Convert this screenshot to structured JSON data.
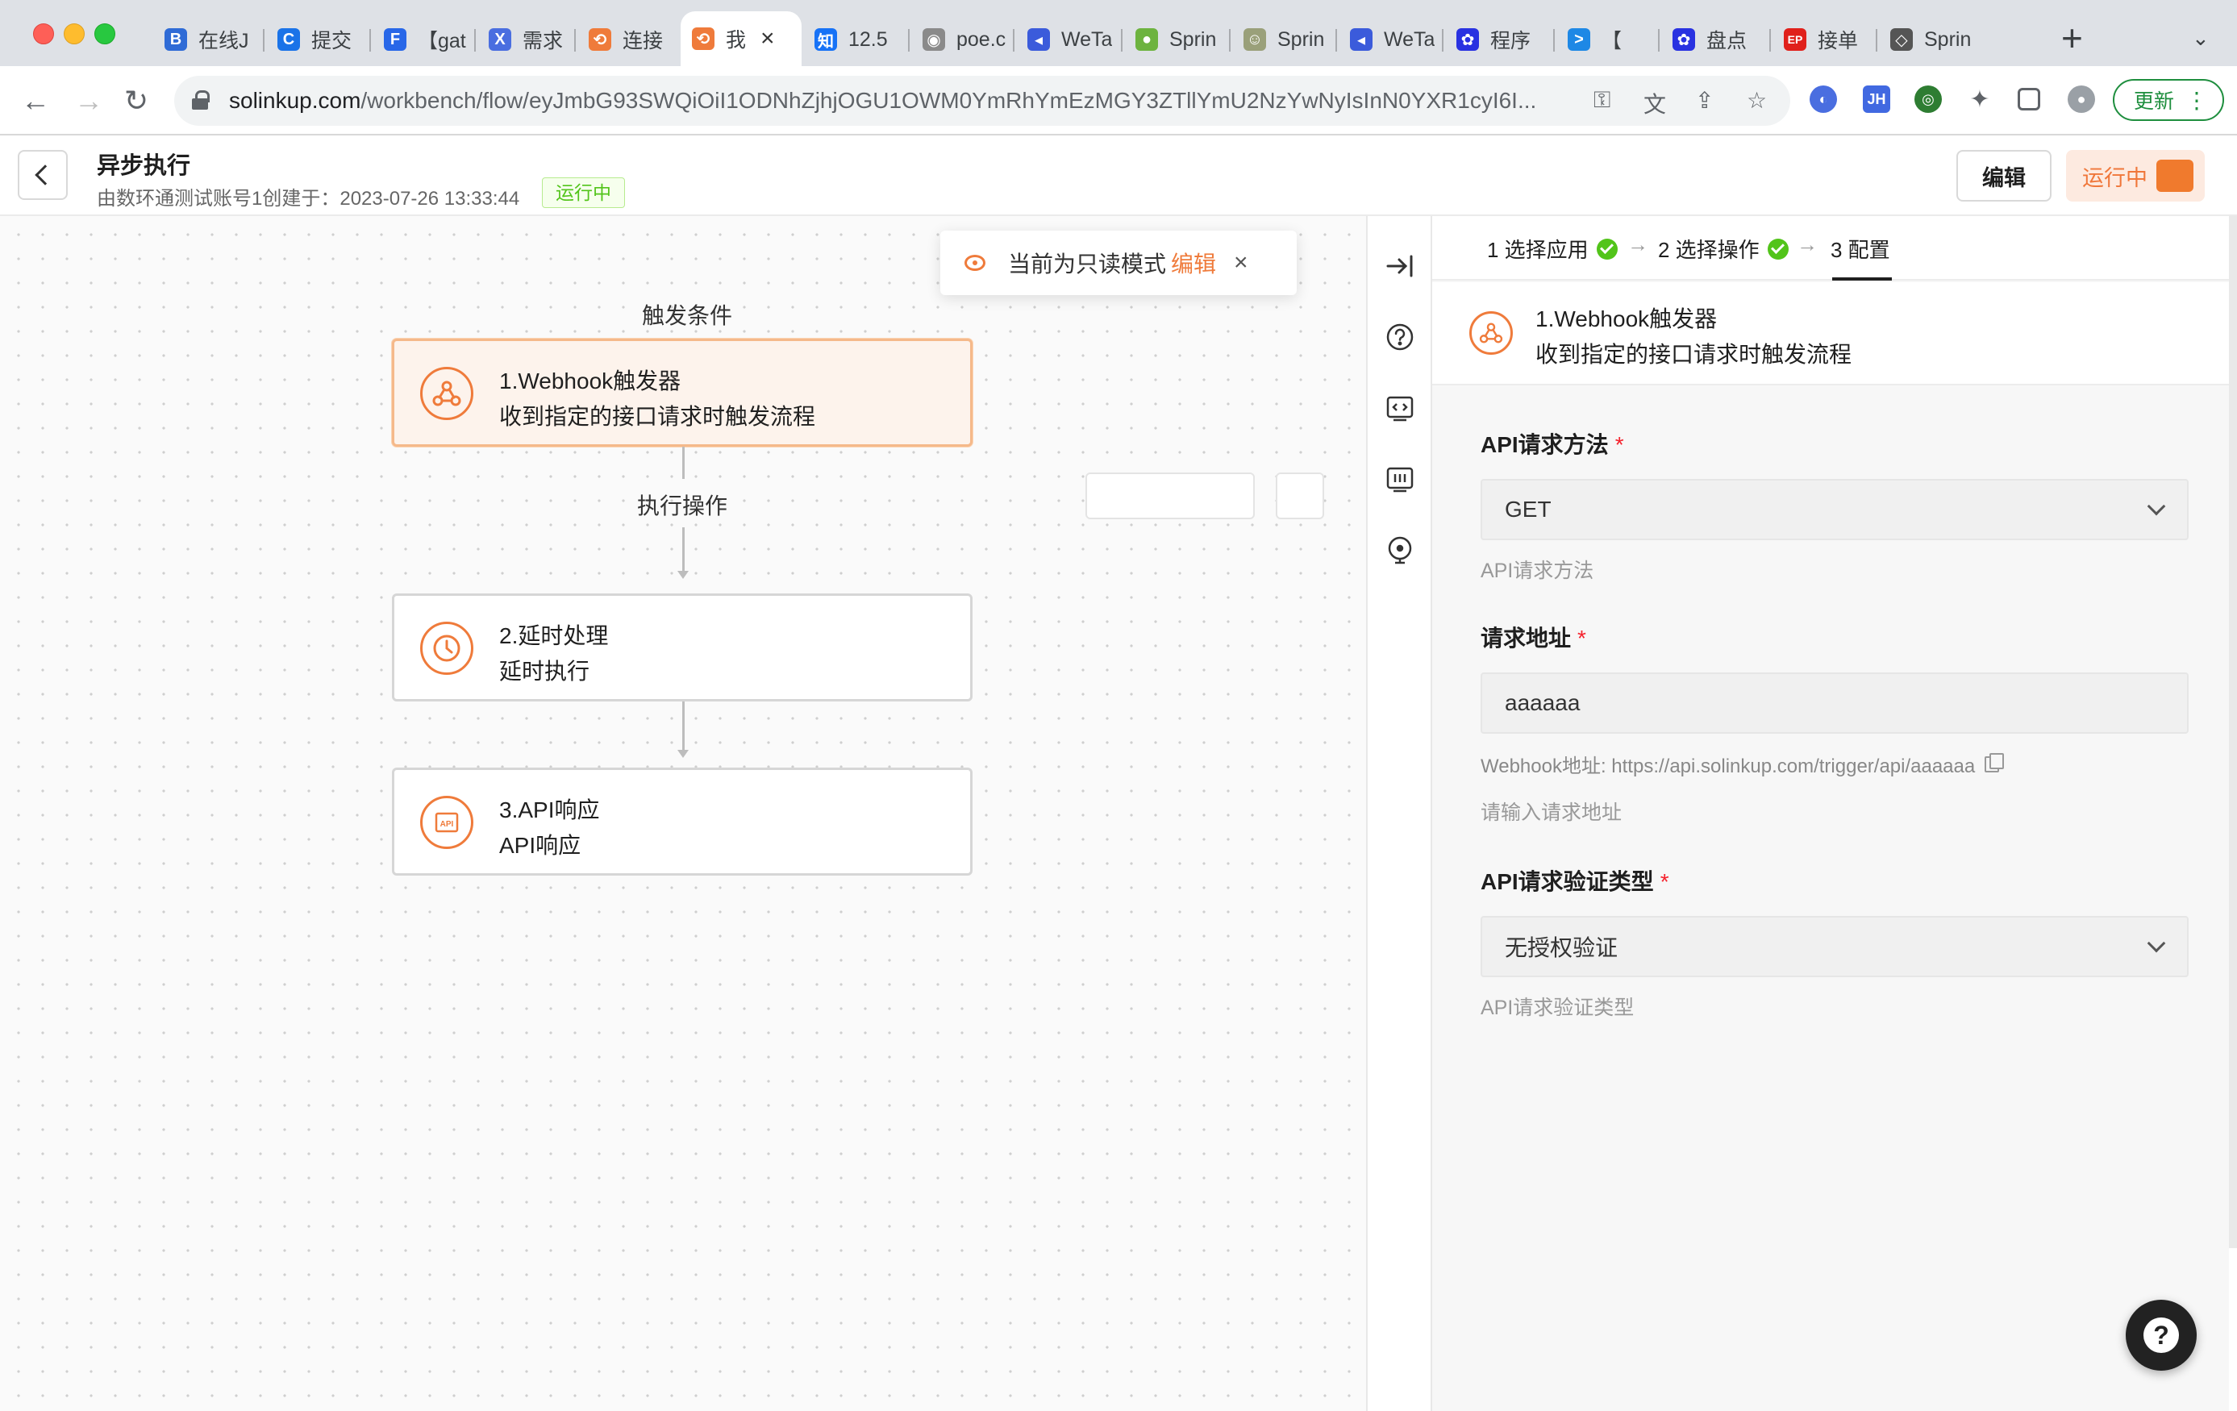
{
  "browser": {
    "tabs": [
      {
        "title": "在线J",
        "fav_color": "#2f6bd6",
        "fav_glyph": "B",
        "icon": "baidu-b-icon"
      },
      {
        "title": "提交",
        "fav_color": "#1a73e8",
        "fav_glyph": "C",
        "icon": "c-logo-icon"
      },
      {
        "title": "【gat",
        "fav_color": "#2867e8",
        "fav_glyph": "F",
        "icon": "f-logo-icon"
      },
      {
        "title": "需求",
        "fav_color": "#4a6ee0",
        "fav_glyph": "X",
        "icon": "x-logo-icon"
      },
      {
        "title": "连接",
        "fav_color": "#ef7b3b",
        "fav_glyph": "⟲",
        "icon": "solinkup-icon"
      },
      {
        "title": "我",
        "fav_color": "#ef7b3b",
        "fav_glyph": "⟲",
        "icon": "solinkup-icon",
        "active": true
      },
      {
        "title": "12.5",
        "fav_color": "#1772f6",
        "fav_glyph": "知",
        "icon": "zhihu-icon"
      },
      {
        "title": "poe.c",
        "fav_color": "#8a8a8a",
        "fav_glyph": "◉",
        "icon": "poe-icon"
      },
      {
        "title": "WeTa",
        "fav_color": "#3b5bdb",
        "fav_glyph": "◂",
        "icon": "weta-icon"
      },
      {
        "title": "Sprin",
        "fav_color": "#6db33f",
        "fav_glyph": "●",
        "icon": "spring-icon"
      },
      {
        "title": "Sprin",
        "fav_color": "#9aa07a",
        "fav_glyph": "☺",
        "icon": "avatar-icon"
      },
      {
        "title": "WeTa",
        "fav_color": "#3b5bdb",
        "fav_glyph": "◂",
        "icon": "weta-icon"
      },
      {
        "title": "程序",
        "fav_color": "#2932e1",
        "fav_glyph": "✿",
        "icon": "baidu-paw-icon"
      },
      {
        "title": "【",
        "fav_color": "#1e88e5",
        "fav_glyph": ">",
        "icon": "terminal-icon"
      },
      {
        "title": "盘点",
        "fav_color": "#2932e1",
        "fav_glyph": "✿",
        "icon": "baidu-paw-icon"
      },
      {
        "title": "接单",
        "fav_color": "#e0201b",
        "fav_glyph": "EP",
        "icon": "ep-icon"
      },
      {
        "title": "Sprin",
        "fav_color": "#555555",
        "fav_glyph": "◇",
        "icon": "openai-icon"
      }
    ],
    "active_tab_close": "×",
    "new_tab": "+",
    "url_host": "solinkup.com",
    "url_path": "/workbench/flow/eyJmbG93SWQiOiI1ODNhZjhjOGU1OWM0YmRhYmEzMGY3ZTllYmU2NzYwNyIsInN0YXR1cyI6I...",
    "update_label": "更新"
  },
  "header": {
    "title": "异步执行",
    "meta": "由数环通测试账号1创建于：2023-07-26 13:33:44",
    "status": "运行中",
    "edit_label": "编辑",
    "run_label": "运行中",
    "accent": "#ef7b3b"
  },
  "canvas": {
    "trigger_label": "触发条件",
    "action_label": "执行操作",
    "nodes": [
      {
        "title": "1.Webhook触发器",
        "subtitle": "收到指定的接口请求时触发流程",
        "icon": "webhook-icon",
        "active": true
      },
      {
        "title": "2.延时处理",
        "subtitle": "延时执行",
        "icon": "clock-icon"
      },
      {
        "title": "3.API响应",
        "subtitle": "API响应",
        "icon": "api-icon"
      }
    ],
    "toast": {
      "text": "当前为只读模式",
      "link": "编辑",
      "close": "×"
    }
  },
  "sidetools": [
    "collapse-panel-icon",
    "help-circle-icon",
    "code-icon",
    "log-icon",
    "debug-icon"
  ],
  "panel": {
    "steps": [
      {
        "label": "1 选择应用",
        "done": true
      },
      {
        "label": "2 选择操作",
        "done": true
      },
      {
        "label": "3 配置",
        "done": false,
        "current": true
      }
    ],
    "step_arrow": "→",
    "trigger_title": "1.Webhook触发器",
    "trigger_subtitle": "收到指定的接口请求时触发流程",
    "fields": {
      "method": {
        "label": "API请求方法",
        "required": "*",
        "value": "GET",
        "help": "API请求方法"
      },
      "address": {
        "label": "请求地址",
        "required": "*",
        "value": "aaaaaa",
        "note": "Webhook地址: https://api.solinkup.com/trigger/api/aaaaaa",
        "help": "请输入请求地址"
      },
      "auth": {
        "label": "API请求验证类型",
        "required": "*",
        "value": "无授权验证",
        "help": "API请求验证类型"
      }
    }
  },
  "fab": "?"
}
